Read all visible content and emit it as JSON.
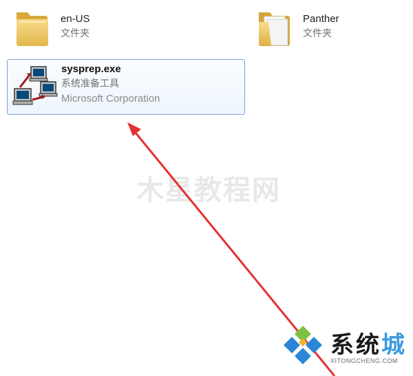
{
  "files": [
    {
      "name": "en-US",
      "type": "文件夹",
      "icon": "folder-icon"
    },
    {
      "name": "Panther",
      "type": "文件夹",
      "icon": "folder-open-icon"
    },
    {
      "name": "sysprep.exe",
      "type": "系统准备工具",
      "company": "Microsoft Corporation",
      "icon": "network-computers-icon",
      "selected": true
    }
  ],
  "watermark": "木星教程网",
  "logo": {
    "brand_main": "系统",
    "brand_accent": "城",
    "url": "XITONGCHENG.COM"
  },
  "colors": {
    "selection_border": "#7da2ce",
    "arrow": "#e53030",
    "folder": "#e8c060"
  }
}
